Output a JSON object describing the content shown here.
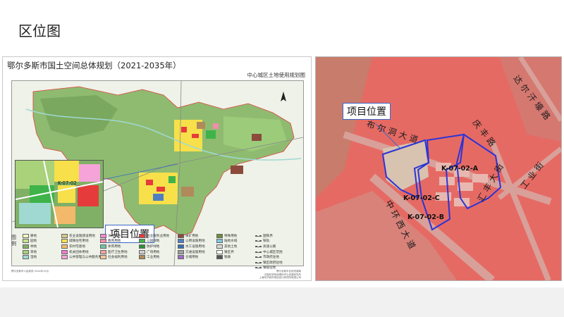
{
  "slide": {
    "title": "区位图"
  },
  "left_map": {
    "title": "鄂尔多斯市国土空间总体规划（2021-2035年）",
    "subtitle": "中心城区土地使用规划图",
    "callout": "项目位置",
    "inset_label": "K-07-02",
    "legend_title": "图例",
    "legend": [
      {
        "label": "耕地",
        "color": "#f3f7c0"
      },
      {
        "label": "农业设施建设用地",
        "color": "#d9c98a"
      },
      {
        "label": "文化用地",
        "color": "#f08bd0"
      },
      {
        "label": "商业服务业用地",
        "color": "#e63b3b"
      },
      {
        "label": "采矿用地",
        "color": "#8b4a3c"
      },
      {
        "label": "特殊用地",
        "color": "#6b8f3a"
      },
      {
        "label": "园地",
        "color": "#c9e28d"
      },
      {
        "label": "城镇住宅用地",
        "color": "#f7e04a"
      },
      {
        "label": "教育用地",
        "color": "#f38ca8"
      },
      {
        "label": "公园绿地",
        "color": "#3fb34a"
      },
      {
        "label": "公用设施用地",
        "color": "#4f7fc2"
      },
      {
        "label": "陆地水域",
        "color": "#7ec6e6"
      },
      {
        "label": "林地",
        "color": "#7fb066"
      },
      {
        "label": "农村宅基地",
        "color": "#f3b96b"
      },
      {
        "label": "体育用地",
        "color": "#6fc3a8"
      },
      {
        "label": "防护绿地",
        "color": "#2f8f3a"
      },
      {
        "label": "水工设施用地",
        "color": "#3b6fb3"
      },
      {
        "label": "其他土地",
        "color": "#d8d8d8"
      },
      {
        "label": "草地",
        "color": "#a9d27a"
      },
      {
        "label": "机关团体用地",
        "color": "#f07ad0"
      },
      {
        "label": "医疗卫生用地",
        "color": "#f3a3a3"
      },
      {
        "label": "广场用地",
        "color": "#cfcfcf"
      },
      {
        "label": "交通设施用地",
        "color": "#a0a0a0"
      },
      {
        "label": "镇区界",
        "color": "#ffffff"
      },
      {
        "label": "湿地",
        "color": "#9fd9d2"
      },
      {
        "label": "公共管理与公共服务用地",
        "color": "#f5a3d8"
      },
      {
        "label": "社会福利用地",
        "color": "#f2c69a"
      },
      {
        "label": "工业用地",
        "color": "#b08a5a"
      },
      {
        "label": "仓储用地",
        "color": "#9b6fc2"
      },
      {
        "label": "铁路",
        "color": "#555555"
      }
    ],
    "legend_extra": [
      {
        "label": "国铁界"
      },
      {
        "label": "铁轨"
      },
      {
        "label": "高速公路"
      },
      {
        "label": "中心城区范围"
      },
      {
        "label": "市政府驻地"
      },
      {
        "label": "镇区政府驻地"
      },
      {
        "label": "镇级驻地"
      }
    ],
    "note_left": "鄂尔多斯市人民政府  2024年12月",
    "note_right_1": "鄂尔多斯市自然资源局",
    "note_right_2": "中国科学院地理科学与资源研究所",
    "note_right_3": "上海同济城市规划设计研究院有限公司"
  },
  "right_map": {
    "callout": "项目位置",
    "roads": {
      "dalate": "达尔汗壕路",
      "buerdong": "布尔洞大道",
      "qingfeng": "庆丰路",
      "gongye": "工业街",
      "zhonghuan": "中环西大道",
      "huifeng": "汇丰大街"
    },
    "parcels": {
      "a": "K-07-02-A",
      "b": "K-07-02-B",
      "c": "K-07-02-C"
    }
  }
}
